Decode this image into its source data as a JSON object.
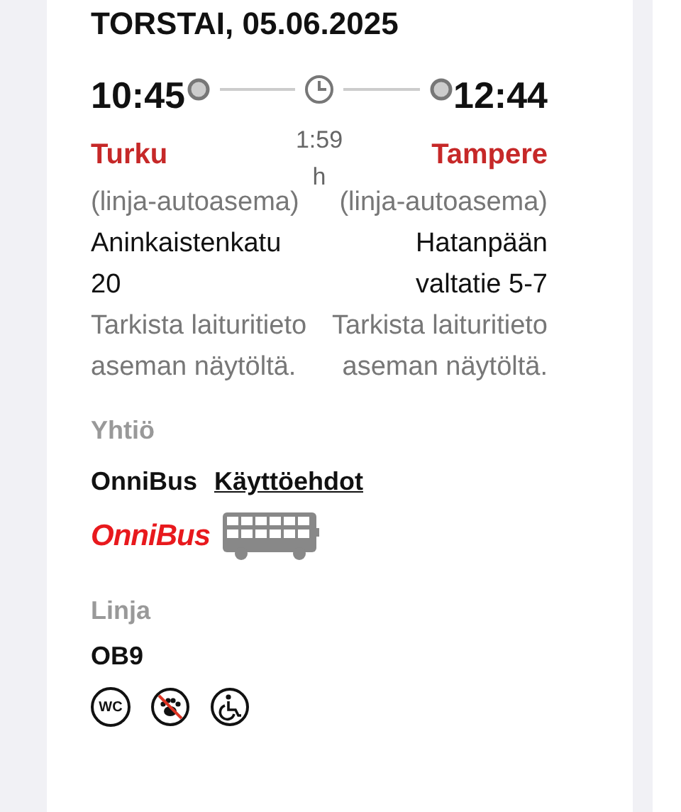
{
  "date": "TORSTAI, 05.06.2025",
  "departure": {
    "time": "10:45",
    "place": "Turku",
    "station": "(linja-autoasema)",
    "address": "Aninkaistenkatu 20",
    "platform_note": "Tarkista laituritieto aseman näytöltä."
  },
  "duration": "1:59 h",
  "arrival": {
    "time": "12:44",
    "place": "Tampere",
    "station": "(linja-autoasema)",
    "address": "Hatanpään valtatie 5-7",
    "platform_note": "Tarkista laituritieto aseman näytöltä."
  },
  "company": {
    "heading": "Yhtiö",
    "name": "OnniBus",
    "terms_link": "Käyttöehdot",
    "logo_text": "OnniBus"
  },
  "line": {
    "heading": "Linja",
    "code": "OB9"
  },
  "amenities": [
    {
      "kind": "wc",
      "label": "WC"
    },
    {
      "kind": "no-pets"
    },
    {
      "kind": "wheelchair"
    }
  ]
}
